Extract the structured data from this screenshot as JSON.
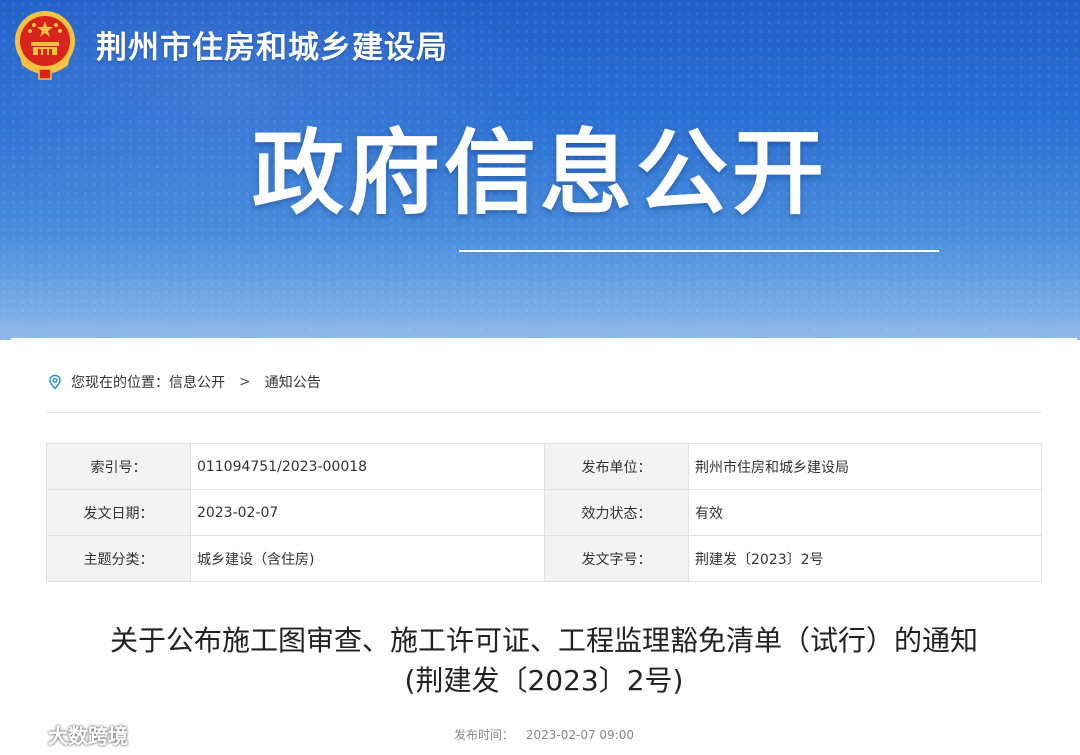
{
  "header": {
    "site_name": "荆州市住房和城乡建设局",
    "banner_title": "政府信息公开"
  },
  "breadcrumb": {
    "prefix": "您现在的位置：",
    "items": [
      "信息公开",
      "通知公告"
    ],
    "separator": ">"
  },
  "meta": {
    "rows": [
      {
        "k1": "索引号：",
        "v1": "011094751/2023-00018",
        "k2": "发布单位：",
        "v2": "荆州市住房和城乡建设局"
      },
      {
        "k1": "发文日期：",
        "v1": "2023-02-07",
        "k2": "效力状态：",
        "v2": "有效"
      },
      {
        "k1": "主题分类：",
        "v1": "城乡建设（含住房)",
        "k2": "发文字号：",
        "v2": "荆建发〔2023〕2号"
      }
    ]
  },
  "document": {
    "title_line1": "关于公布施工图审查、施工许可证、工程监理豁免清单（试行）的通知",
    "title_line2": "(荆建发〔2023〕2号)",
    "publish_label": "发布时间：",
    "publish_time": "2023-02-07 09:00"
  },
  "watermark": {
    "text": "大数跨境"
  },
  "colors": {
    "banner_blue": "#2b70d3",
    "emblem_red": "#d8231d",
    "emblem_gold": "#f5c242"
  },
  "icons": [
    "national-emblem-icon",
    "location-pin-icon",
    "watermark-logo-icon"
  ]
}
